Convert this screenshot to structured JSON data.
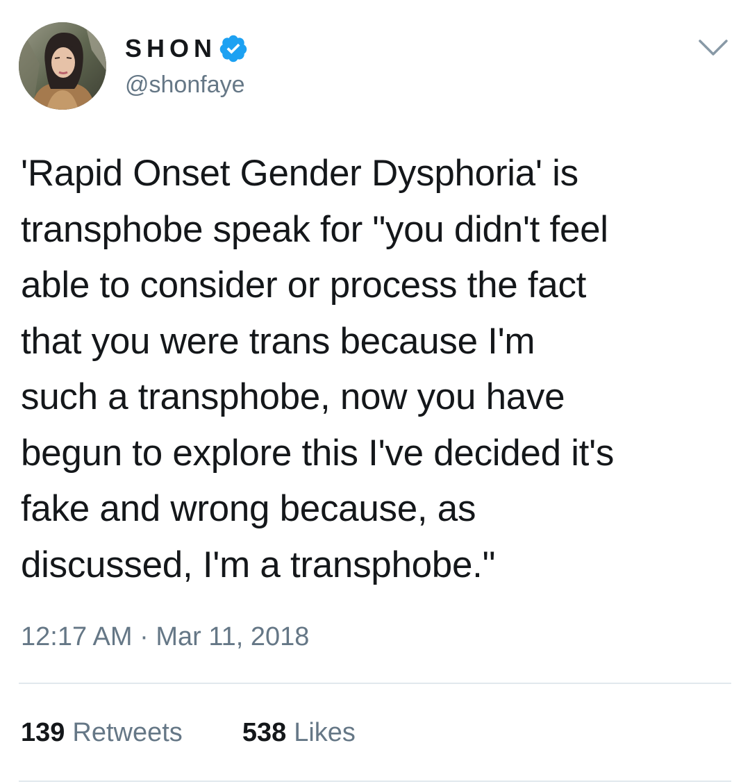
{
  "tweet": {
    "author": {
      "display_name": "SHON",
      "handle": "@shonfaye",
      "verified": true
    },
    "text": "'Rapid Onset Gender Dysphoria' is\ntransphobe speak for \"you didn't feel\nable to consider or process the fact\nthat you were trans because I'm\nsuch a transphobe, now you have\nbegun to explore this I've decided it's\nfake and wrong because, as\ndiscussed, I'm a transphobe.\"",
    "timestamp": "12:17 AM · Mar 11, 2018",
    "stats": {
      "retweets_count": "139",
      "retweets_label": "Retweets",
      "likes_count": "538",
      "likes_label": "Likes"
    }
  },
  "icons": {
    "verified": "verified-badge-icon",
    "menu": "chevron-down-icon"
  },
  "colors": {
    "text_primary": "#14171a",
    "text_secondary": "#657786",
    "verified_blue": "#1da1f2",
    "divider": "#e1e8ed"
  }
}
